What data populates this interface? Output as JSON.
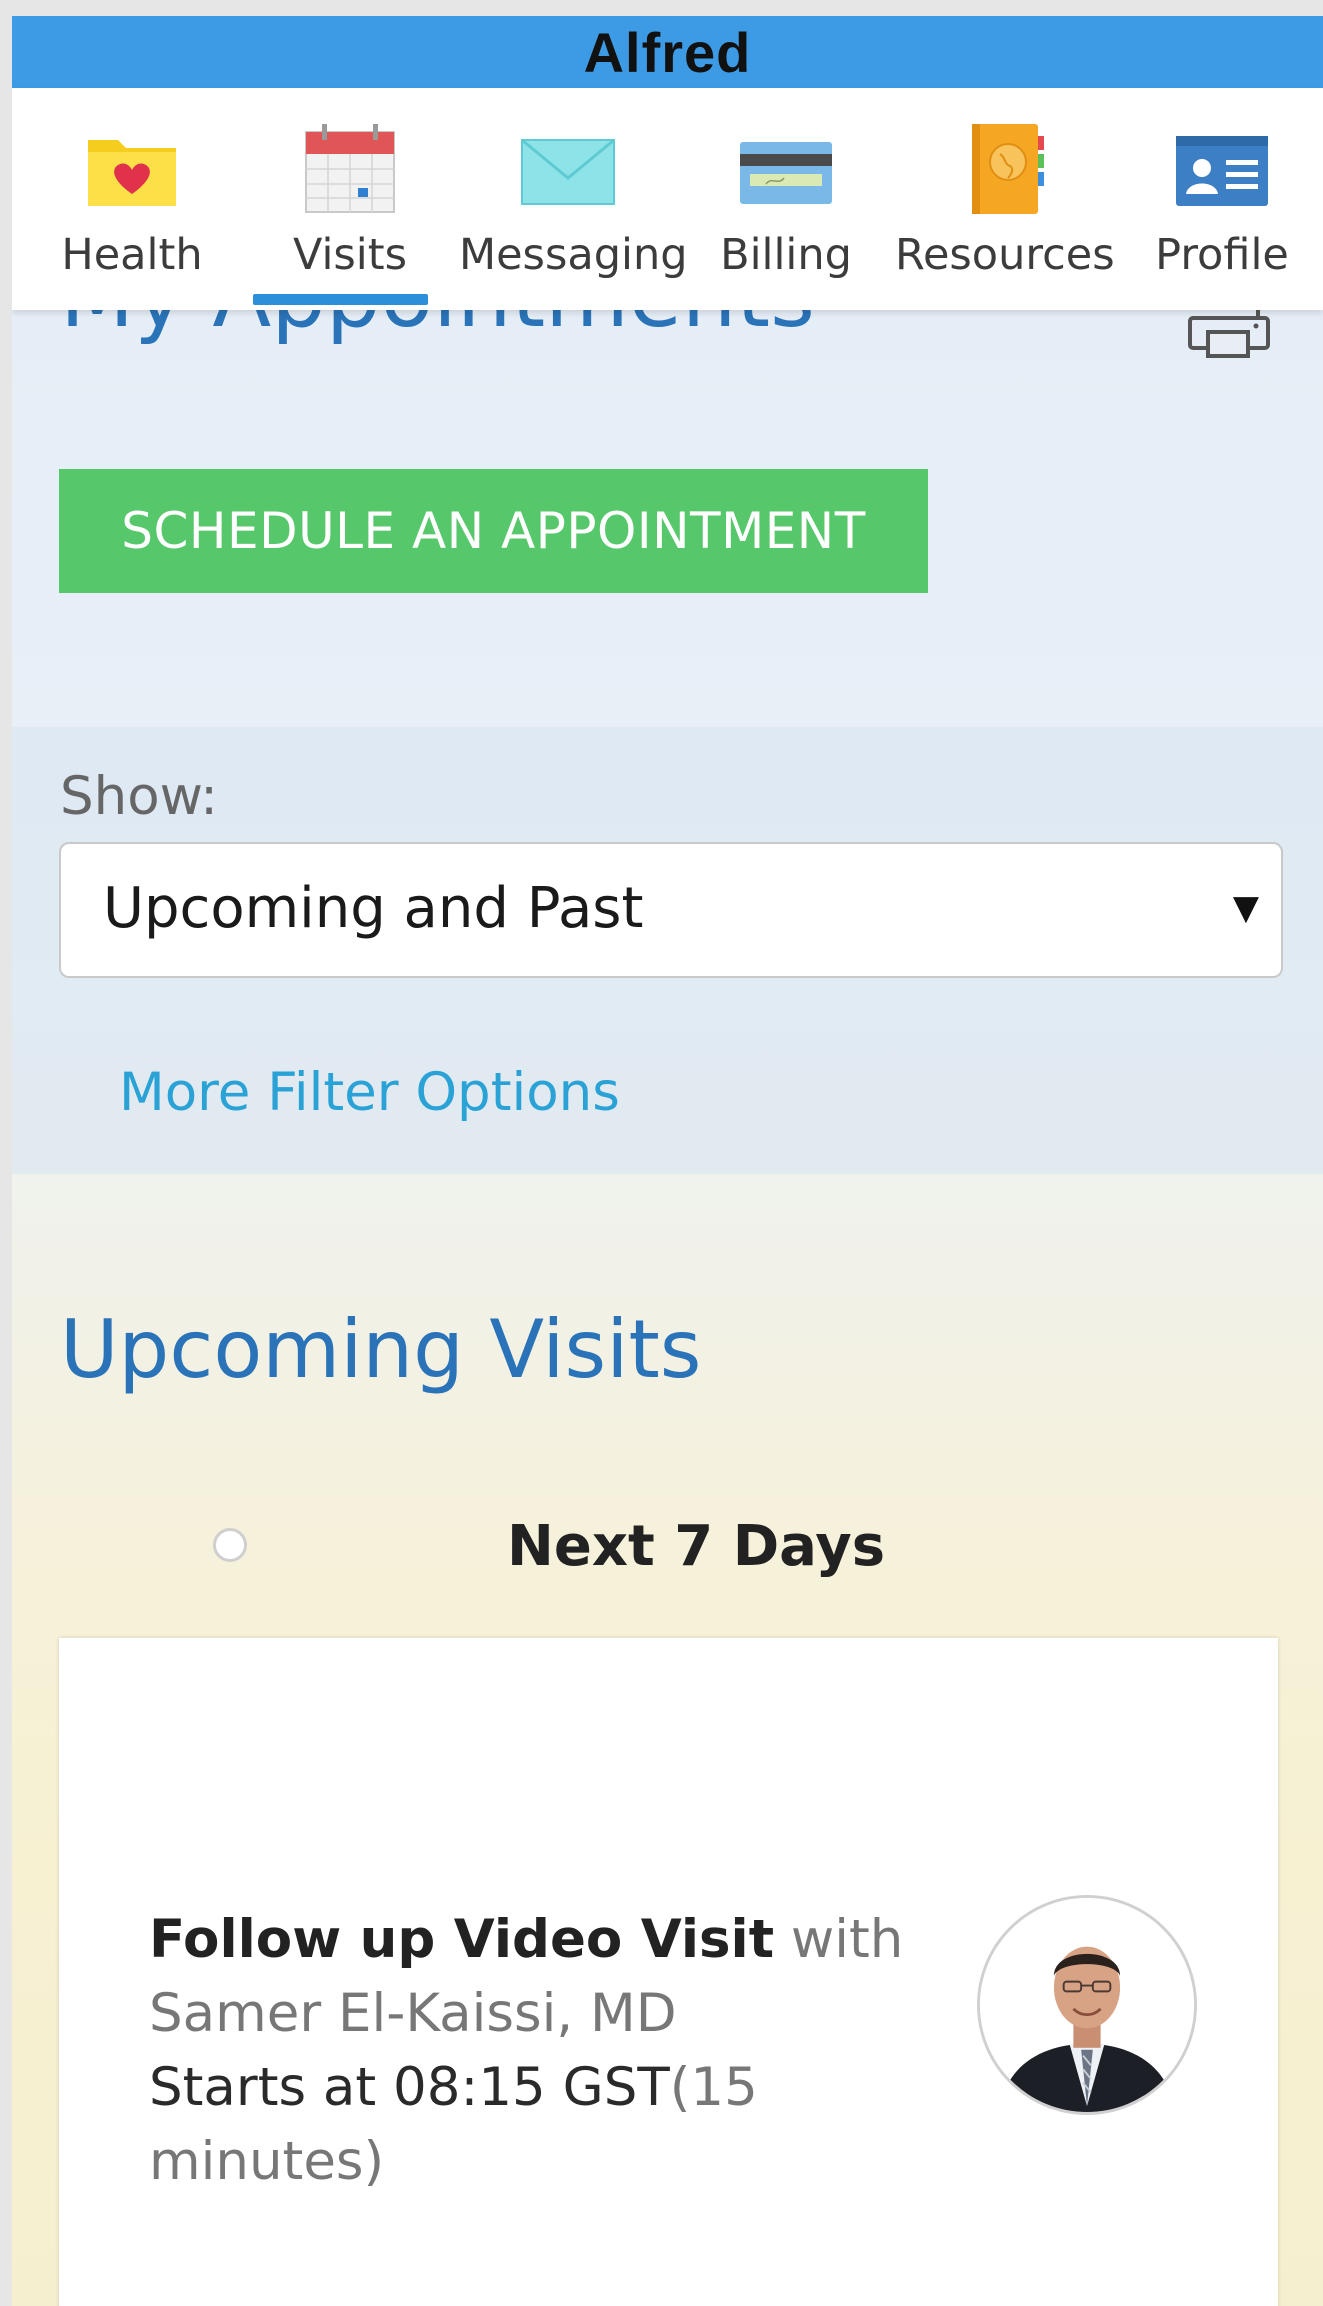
{
  "app": {
    "title": "Alfred",
    "accent_color": "#3d9be5"
  },
  "nav": {
    "active": "Visits",
    "items": [
      {
        "label": "Health",
        "icon": "folder-heart-icon"
      },
      {
        "label": "Visits",
        "icon": "calendar-icon"
      },
      {
        "label": "Messaging",
        "icon": "envelope-icon"
      },
      {
        "label": "Billing",
        "icon": "credit-card-icon"
      },
      {
        "label": "Resources",
        "icon": "book-globe-icon"
      },
      {
        "label": "Profile",
        "icon": "id-card-icon"
      }
    ]
  },
  "page": {
    "title": "My Appointments",
    "print_icon": "print-icon",
    "schedule_button": "SCHEDULE AN APPOINTMENT",
    "schedule_button_color": "#57c76b"
  },
  "filter": {
    "show_label": "Show:",
    "selected": "Upcoming and Past",
    "more_options": "More Filter Options"
  },
  "upcoming": {
    "title": "Upcoming Visits",
    "period": "Next 7 Days",
    "visits": [
      {
        "type": "Follow up Video Visit",
        "with_word": " with",
        "provider": "Samer El-Kaissi, MD",
        "start_prefix": "Starts at 08:15 GST",
        "duration": "(15 minutes)"
      }
    ]
  }
}
